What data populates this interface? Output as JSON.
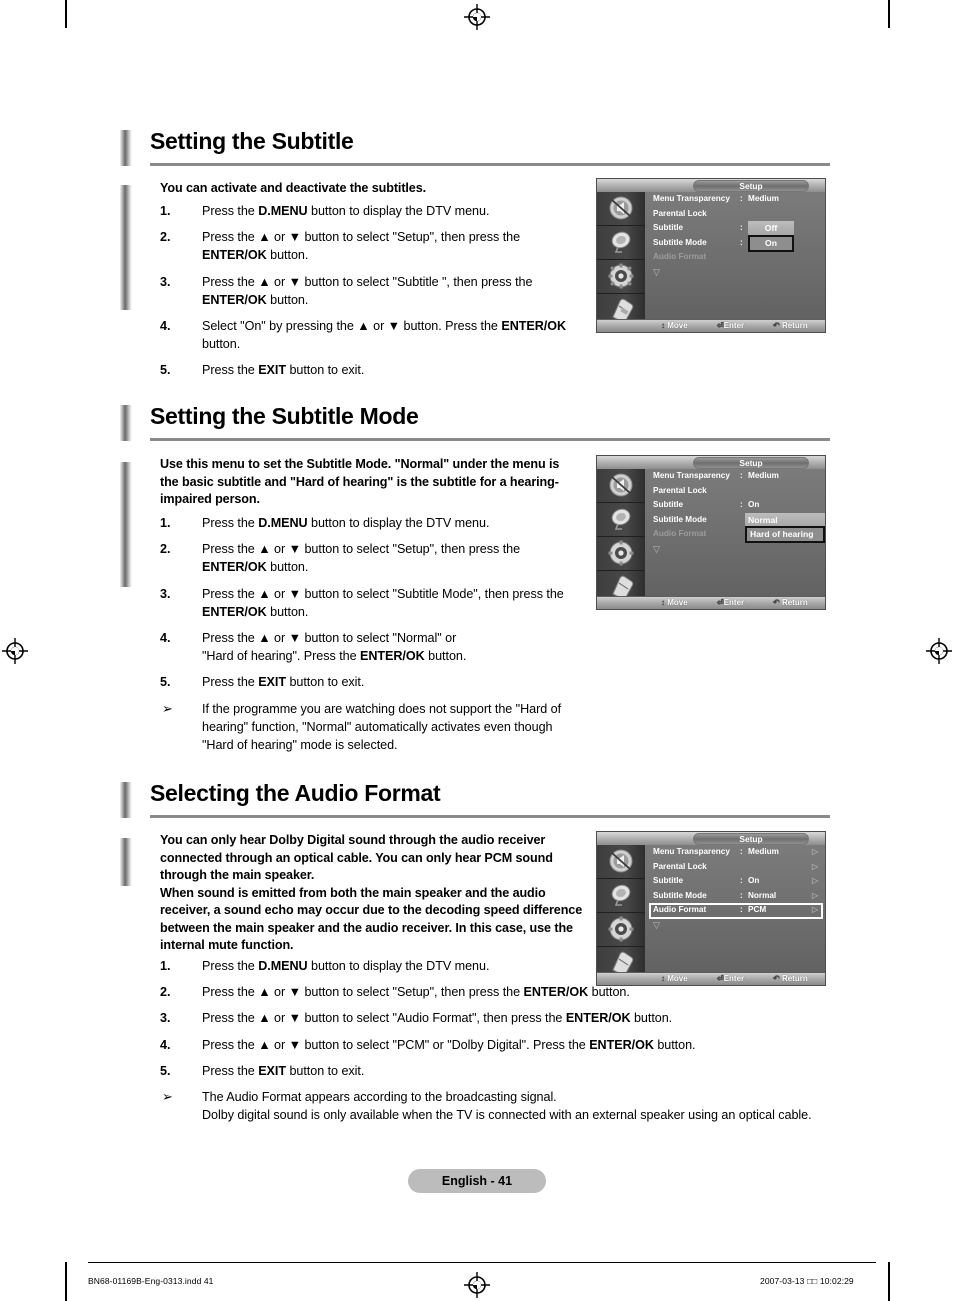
{
  "page": {
    "badge": "English - 41",
    "imposition_file": "BN68-01169B-Eng-0313.indd   41",
    "imposition_date": "2007-03-13   □□ 10:02:29"
  },
  "sections": [
    {
      "title": "Setting the Subtitle",
      "lead": "You can activate and deactivate the subtitles.",
      "steps": [
        {
          "num": "1.",
          "html": "Press the <b>D.MENU</b> button to display the DTV menu."
        },
        {
          "num": "2.",
          "html": "Press the ▲ or ▼ button to select \"Setup\", then press the <b>ENTER/OK</b> button."
        },
        {
          "num": "3.",
          "html": "Press the ▲ or ▼ button to select \"Subtitle \", then press the <b>ENTER/OK</b> button."
        },
        {
          "num": "4.",
          "html": "Select \"On\" by pressing the ▲ or ▼ button. Press the <b>ENTER/OK</b> button."
        },
        {
          "num": "5.",
          "html": "Press the <b>EXIT</b> button to exit."
        }
      ]
    },
    {
      "title": "Setting the Subtitle Mode",
      "lead": "Use this menu to set the Subtitle Mode. \"Normal\" under the menu is the basic subtitle and \"Hard of hearing\" is the subtitle for a hearing-impaired person.",
      "steps": [
        {
          "num": "1.",
          "html": "Press the <b>D.MENU</b> button to display the DTV menu."
        },
        {
          "num": "2.",
          "html": "Press the ▲ or ▼ button to select \"Setup\", then press the <b>ENTER/OK</b> button."
        },
        {
          "num": "3.",
          "html": "Press the ▲ or ▼ button to select \"Subtitle  Mode\", then press the <b>ENTER/OK</b> button."
        },
        {
          "num": "4.",
          "html": "Press the ▲ or ▼ button to select \"Normal\" or<br>\"Hard of hearing\". Press the <b>ENTER/OK</b> button."
        },
        {
          "num": "5.",
          "html": "Press the <b>EXIT</b> button to exit."
        },
        {
          "num": "➢",
          "bullet": true,
          "html": "If the programme you are watching does not support the \"Hard of hearing\" function, \"Normal\" automatically activates even though \"Hard of hearing\" mode is selected."
        }
      ]
    },
    {
      "title": "Selecting the Audio Format",
      "lead": "You can only hear Dolby Digital sound through the audio receiver connected through an optical cable. You can only hear PCM sound through the main speaker.<br>When sound is emitted from both the main speaker and the audio receiver, a sound echo may occur due to the decoding speed difference between the main speaker and the audio receiver. In this case, use the internal mute function.",
      "steps": [
        {
          "num": "1.",
          "html": "Press the <b>D.MENU</b> button to display the DTV menu."
        },
        {
          "num": "2.",
          "html": "Press the ▲ or ▼ button to select \"Setup\", then press the <b>ENTER/OK</b> button."
        },
        {
          "num": "3.",
          "html": "Press the ▲ or ▼ button to select \"Audio Format\", then press the <b>ENTER/OK</b> button."
        },
        {
          "num": "4.",
          "html": "Press the ▲ or ▼ button to select \"PCM\" or \"Dolby Digital\". Press the <b>ENTER/OK</b> button."
        },
        {
          "num": "5.",
          "html": "Press the <b>EXIT</b> button to exit."
        },
        {
          "num": "➢",
          "bullet": true,
          "html": "The Audio Format appears according to the broadcasting signal.<br>Dolby digital sound is only available when the TV is connected with an external speaker using an optical cable."
        }
      ]
    }
  ],
  "osd": {
    "title": "Setup",
    "hints": {
      "move": "Move",
      "enter": "Enter",
      "return": "Return"
    },
    "hint_glyphs": {
      "move": "↕",
      "enter": "⏎",
      "return": "↺"
    },
    "caret": "▽",
    "arrow": "▷",
    "icons": [
      "mute-icon",
      "satellite-dish-icon",
      "setup-gear-icon",
      "remote-control-icon"
    ],
    "screens": [
      {
        "id": "subtitle",
        "rows": [
          {
            "label": "Menu Transparency",
            "colon": ":",
            "value": "Medium"
          },
          {
            "label": "Parental Lock",
            "colon": "",
            "value": ""
          },
          {
            "label": "Subtitle",
            "colon": ":",
            "value": ""
          },
          {
            "label": "Subtitle  Mode",
            "colon": ":",
            "value": ""
          },
          {
            "label": "Audio Format",
            "colon": "",
            "value": "",
            "dim": true
          }
        ],
        "options": [
          {
            "text": "Off",
            "style": "light"
          },
          {
            "text": "On",
            "style": "box"
          }
        ]
      },
      {
        "id": "subtitle-mode",
        "rows": [
          {
            "label": "Menu Transparency",
            "colon": ":",
            "value": "Medium"
          },
          {
            "label": "Parental Lock",
            "colon": "",
            "value": ""
          },
          {
            "label": "Subtitle",
            "colon": ":",
            "value": "On"
          },
          {
            "label": "Subtitle  Mode",
            "colon": "",
            "value": ""
          },
          {
            "label": "Audio Format",
            "colon": "",
            "value": "",
            "dim": true
          }
        ],
        "options": [
          {
            "text": "Normal",
            "style": "light"
          },
          {
            "text": "Hard of hearing",
            "style": "box"
          }
        ]
      },
      {
        "id": "audio-format",
        "rows": [
          {
            "label": "Menu Transparency",
            "colon": ":",
            "value": "Medium",
            "arrow": true
          },
          {
            "label": "Parental Lock",
            "colon": "",
            "value": "",
            "arrow": true
          },
          {
            "label": "Subtitle",
            "colon": ":",
            "value": "On",
            "arrow": true
          },
          {
            "label": "Subtitle  Mode",
            "colon": ":",
            "value": "Normal",
            "arrow": true
          },
          {
            "label": "Audio Format",
            "colon": ":",
            "value": "PCM",
            "arrow": true,
            "selected": true
          }
        ],
        "options": []
      }
    ]
  }
}
